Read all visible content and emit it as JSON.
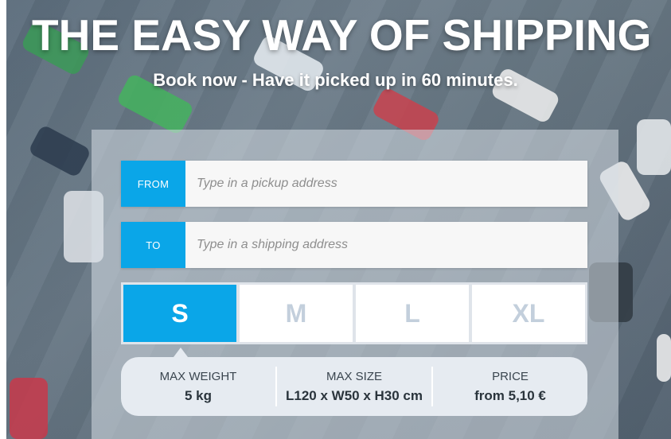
{
  "hero": {
    "headline": "THE EASY WAY OF SHIPPING",
    "subline": "Book now - Have it picked up in 60 minutes."
  },
  "form": {
    "from": {
      "label": "FROM",
      "placeholder": "Type in a pickup address"
    },
    "to": {
      "label": "TO",
      "placeholder": "Type in a shipping address"
    },
    "sizes": [
      "S",
      "M",
      "L",
      "XL"
    ],
    "selected_size": "S",
    "specs": [
      {
        "label": "MAX WEIGHT",
        "value": "5 kg"
      },
      {
        "label": "MAX SIZE",
        "value": "L120 x W50 x H30 cm"
      },
      {
        "label": "PRICE",
        "value": "from 5,10 €"
      }
    ]
  },
  "colors": {
    "accent": "#0aa6e8",
    "inactive_size": "#c3cfdc",
    "specs_bg": "#e6ebf1"
  }
}
